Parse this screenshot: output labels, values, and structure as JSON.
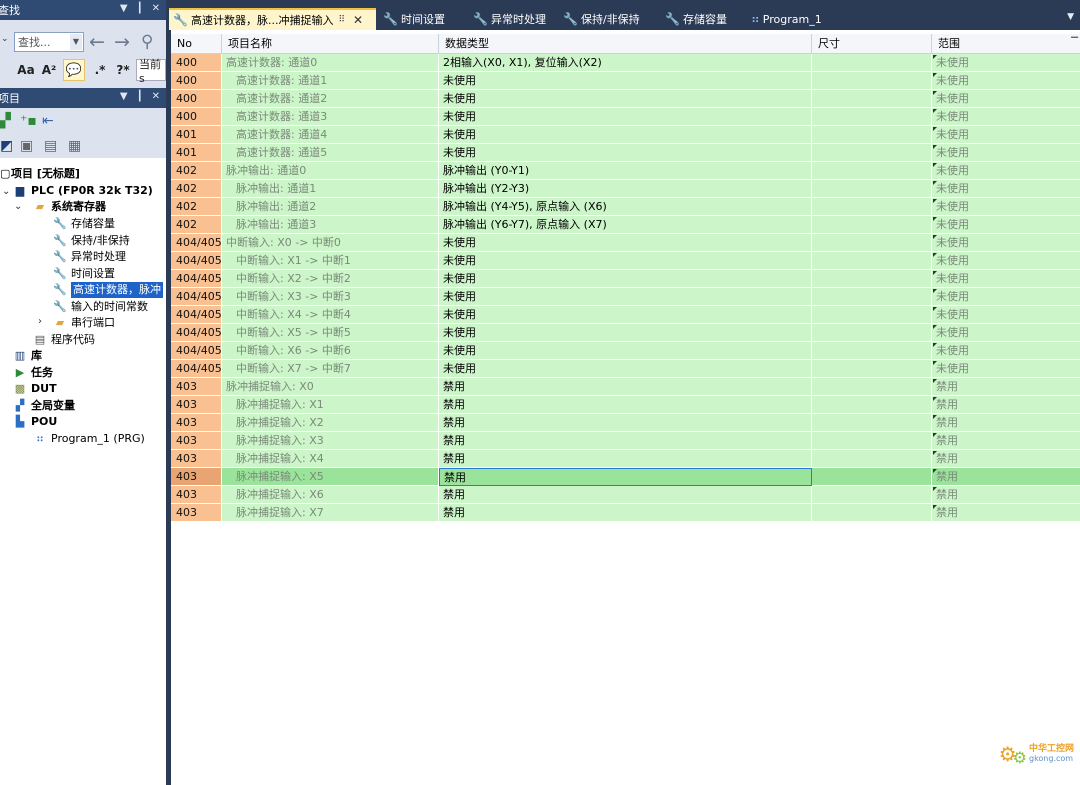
{
  "find_panel": {
    "title": "查找",
    "search_placeholder": "查找...",
    "case_label": "Aa",
    "word_label": "A²",
    "regex_label": ".*",
    "wildcard_label": "?*",
    "scope_label": "当前s"
  },
  "project_panel": {
    "title": "项目",
    "tree": {
      "root": "项目 [无标题]",
      "plc": "PLC (FP0R 32k T32)",
      "sysreg": "系统寄存器",
      "sysreg_items": [
        "存储容量",
        "保持/非保持",
        "异常时处理",
        "时间设置",
        "高速计数器，脉冲",
        "输入的时间常数",
        "串行端口"
      ],
      "program_code": "程序代码",
      "library": "库",
      "task": "任务",
      "dut": "DUT",
      "global_vars": "全局变量",
      "pou": "POU",
      "program": "Program_1 (PRG)"
    }
  },
  "tabs": [
    {
      "label": "高速计数器，脉...冲捕捉输入",
      "pin": "⠿",
      "active": true
    },
    {
      "label": "时间设置",
      "active": false
    },
    {
      "label": "异常时处理",
      "active": false
    },
    {
      "label": "保持/非保持",
      "active": false
    },
    {
      "label": "存储容量",
      "active": false
    },
    {
      "label": "Program_1",
      "active": false
    }
  ],
  "table": {
    "columns": [
      "No",
      "项目名称",
      "数据类型",
      "尺寸",
      "范围"
    ],
    "rows": [
      {
        "no": "400",
        "name": "高速计数器: 通道0",
        "type": "2相输入(X0, X1), 复位输入(X2)",
        "range": "未使用",
        "indent": false
      },
      {
        "no": "400",
        "name": "高速计数器: 通道1",
        "type": "未使用",
        "range": "未使用",
        "indent": true
      },
      {
        "no": "400",
        "name": "高速计数器: 通道2",
        "type": "未使用",
        "range": "未使用",
        "indent": true
      },
      {
        "no": "400",
        "name": "高速计数器: 通道3",
        "type": "未使用",
        "range": "未使用",
        "indent": true
      },
      {
        "no": "401",
        "name": "高速计数器: 通道4",
        "type": "未使用",
        "range": "未使用",
        "indent": true
      },
      {
        "no": "401",
        "name": "高速计数器: 通道5",
        "type": "未使用",
        "range": "未使用",
        "indent": true
      },
      {
        "no": "402",
        "name": "脉冲输出: 通道0",
        "type": "脉冲输出 (Y0-Y1)",
        "range": "未使用",
        "indent": false
      },
      {
        "no": "402",
        "name": "脉冲输出: 通道1",
        "type": "脉冲输出 (Y2-Y3)",
        "range": "未使用",
        "indent": true
      },
      {
        "no": "402",
        "name": "脉冲输出: 通道2",
        "type": "脉冲输出 (Y4-Y5), 原点输入 (X6)",
        "range": "未使用",
        "indent": true
      },
      {
        "no": "402",
        "name": "脉冲输出: 通道3",
        "type": "脉冲输出 (Y6-Y7), 原点输入 (X7)",
        "range": "未使用",
        "indent": true
      },
      {
        "no": "404/405",
        "name": "中断输入: X0 -> 中断0",
        "type": "未使用",
        "range": "未使用",
        "indent": false
      },
      {
        "no": "404/405",
        "name": "中断输入: X1 -> 中断1",
        "type": "未使用",
        "range": "未使用",
        "indent": true
      },
      {
        "no": "404/405",
        "name": "中断输入: X2 -> 中断2",
        "type": "未使用",
        "range": "未使用",
        "indent": true
      },
      {
        "no": "404/405",
        "name": "中断输入: X3 -> 中断3",
        "type": "未使用",
        "range": "未使用",
        "indent": true
      },
      {
        "no": "404/405",
        "name": "中断输入: X4 -> 中断4",
        "type": "未使用",
        "range": "未使用",
        "indent": true
      },
      {
        "no": "404/405",
        "name": "中断输入: X5 -> 中断5",
        "type": "未使用",
        "range": "未使用",
        "indent": true
      },
      {
        "no": "404/405",
        "name": "中断输入: X6 -> 中断6",
        "type": "未使用",
        "range": "未使用",
        "indent": true
      },
      {
        "no": "404/405",
        "name": "中断输入: X7 -> 中断7",
        "type": "未使用",
        "range": "未使用",
        "indent": true
      },
      {
        "no": "403",
        "name": "脉冲捕捉输入: X0",
        "type": "禁用",
        "range": "禁用",
        "indent": false
      },
      {
        "no": "403",
        "name": "脉冲捕捉输入: X1",
        "type": "禁用",
        "range": "禁用",
        "indent": true
      },
      {
        "no": "403",
        "name": "脉冲捕捉输入: X2",
        "type": "禁用",
        "range": "禁用",
        "indent": true
      },
      {
        "no": "403",
        "name": "脉冲捕捉输入: X3",
        "type": "禁用",
        "range": "禁用",
        "indent": true
      },
      {
        "no": "403",
        "name": "脉冲捕捉输入: X4",
        "type": "禁用",
        "range": "禁用",
        "indent": true
      },
      {
        "no": "403",
        "name": "脉冲捕捉输入: X5",
        "type": "禁用",
        "range": "禁用",
        "indent": true,
        "selected": true
      },
      {
        "no": "403",
        "name": "脉冲捕捉输入: X6",
        "type": "禁用",
        "range": "禁用",
        "indent": true
      },
      {
        "no": "403",
        "name": "脉冲捕捉输入: X7",
        "type": "禁用",
        "range": "禁用",
        "indent": true
      }
    ]
  },
  "watermark": {
    "brand": "中华工控网",
    "site": "gkong.com"
  },
  "colors": {
    "row_bg": "#ccf5c9",
    "row_selected": "#9ae39a",
    "no_col": "#f9c192",
    "title_bar": "#2f4a73",
    "tab_active": "#fff5cc"
  }
}
